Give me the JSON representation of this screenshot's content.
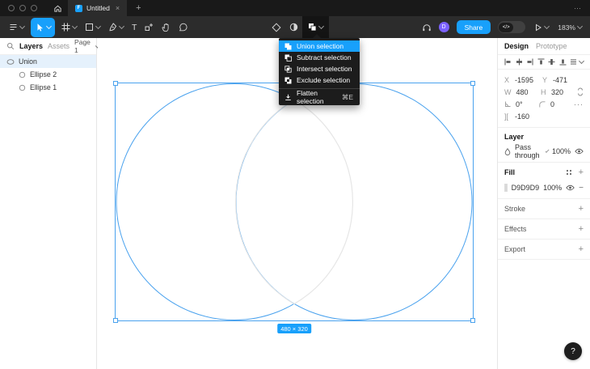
{
  "colors": {
    "accent": "#18a0fb",
    "fill_swatch": "#D9D9D9",
    "selection_stroke": "#4aa2ee",
    "menu_bg": "#1c1c1c"
  },
  "tabbar": {
    "tab_title": "Untitled",
    "close": "×",
    "new_tab": "+",
    "window_more": "⋯"
  },
  "toolbar": {
    "share_label": "Share",
    "zoom_level": "183%",
    "avatar_initial": "D",
    "dev_toggle_label": "</>",
    "text_tool": "T"
  },
  "boolean_menu": {
    "items": [
      {
        "label": "Union selection",
        "shortcut": ""
      },
      {
        "label": "Subtract selection",
        "shortcut": ""
      },
      {
        "label": "Intersect selection",
        "shortcut": ""
      },
      {
        "label": "Exclude selection",
        "shortcut": ""
      },
      {
        "label": "Flatten selection",
        "shortcut": "⌘E"
      }
    ]
  },
  "left_sidebar": {
    "layers_tab": "Layers",
    "assets_tab": "Assets",
    "page_selector": "Page 1",
    "layers": [
      {
        "name": "Union"
      },
      {
        "name": "Ellipse 2"
      },
      {
        "name": "Ellipse 1"
      }
    ]
  },
  "canvas": {
    "dimension_badge": "480 × 320"
  },
  "inspector": {
    "design_tab": "Design",
    "prototype_tab": "Prototype",
    "x_label": "X",
    "x_value": "-1595",
    "y_label": "Y",
    "y_value": "-471",
    "w_label": "W",
    "w_value": "480",
    "h_label": "H",
    "h_value": "320",
    "rotation_value": "0°",
    "radius_value": "0",
    "more": "···",
    "spacing_icon": "][",
    "spacing_value": "-160",
    "layer": {
      "title": "Layer",
      "blend_mode": "Pass through",
      "opacity": "100%"
    },
    "fill": {
      "title": "Fill",
      "hex": "D9D9D9",
      "opacity": "100%",
      "remove": "−"
    },
    "stroke_title": "Stroke",
    "effects_title": "Effects",
    "export_title": "Export",
    "add": "+"
  },
  "help_label": "?"
}
